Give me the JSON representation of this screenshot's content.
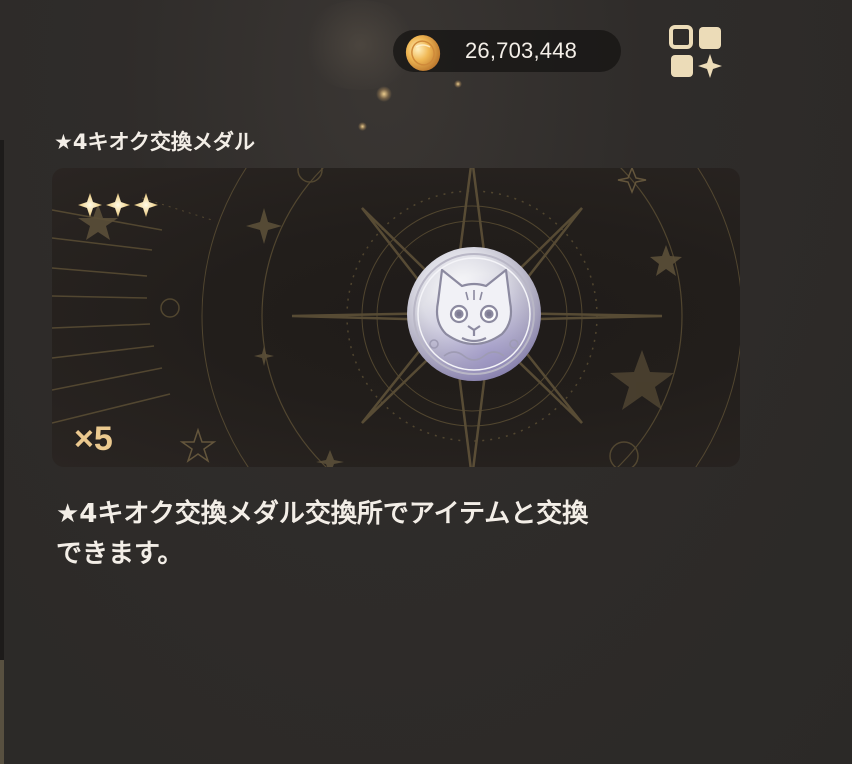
{
  "header": {
    "currency": {
      "icon": "gold-coin-icon",
      "value": "26,703,448"
    },
    "menu": {
      "icon": "grid-menu-icon"
    }
  },
  "item": {
    "title": "★4キオク交換メダル",
    "rarity_stars": 3,
    "quantity": "×5",
    "medal_icon": "silver-cat-medal-icon",
    "description": "★4キオク交換メダル交換所でアイテムと交換\nできます。"
  },
  "colors": {
    "background": "#2e2b29",
    "card": "#221e1b",
    "gold_accent": "#ebc98f",
    "text": "#f3eee7"
  }
}
